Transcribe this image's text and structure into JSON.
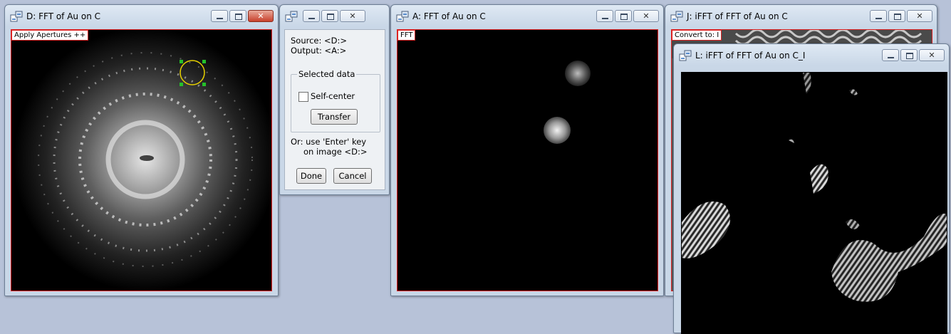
{
  "windows": {
    "d": {
      "title": "D: FFT of Au on C",
      "overlay": "Apply Apertures ++"
    },
    "tool": {
      "source": "Source: <D:>",
      "output": "Output: <A:>",
      "group_title": "Selected data",
      "self_center": "Self-center",
      "transfer": "Transfer",
      "hint_line1": "Or: use 'Enter' key",
      "hint_line2": "on image <D:>",
      "done": "Done",
      "cancel": "Cancel"
    },
    "a": {
      "title": "A: FFT of Au on C",
      "overlay": "FFT"
    },
    "j": {
      "title": "J: iFFT of FFT of Au on C",
      "overlay": "Convert to: I"
    },
    "l": {
      "title": "L: iFFT of FFT of Au on C_I"
    }
  },
  "controls": {
    "minimize": "–",
    "maximize": "□",
    "close": "✕"
  }
}
